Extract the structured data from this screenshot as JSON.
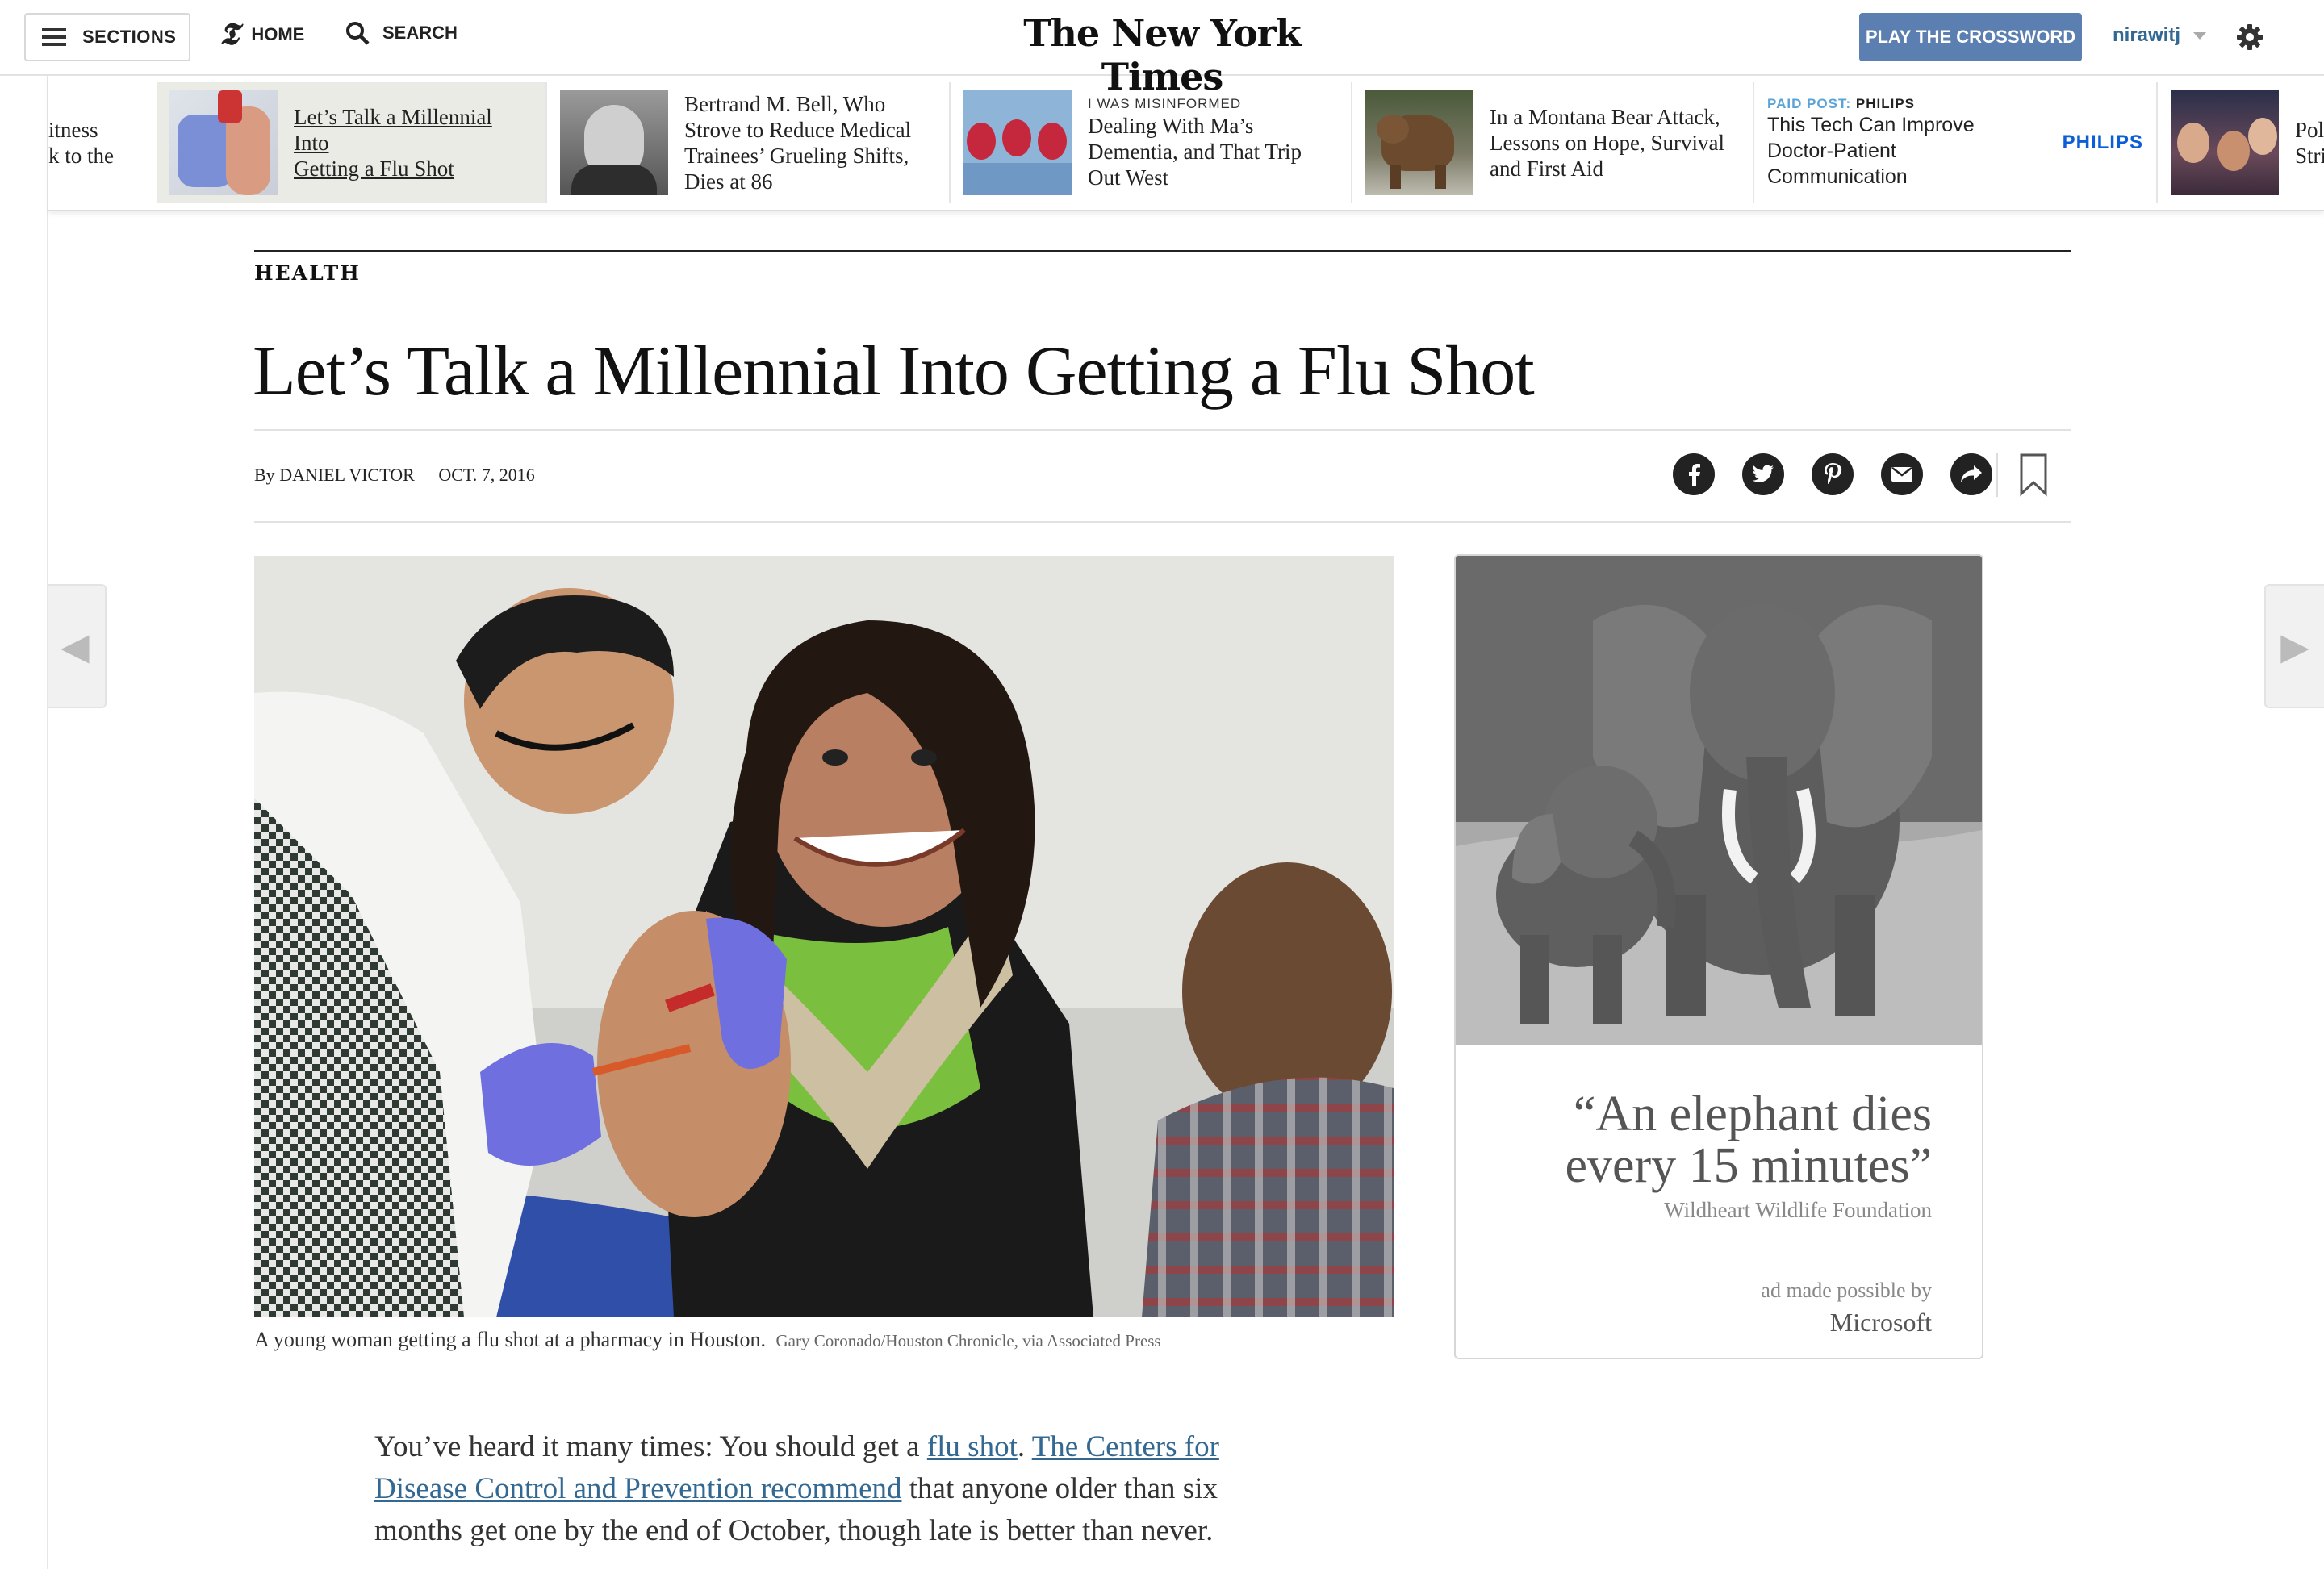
{
  "topbar": {
    "sections_label": "SECTIONS",
    "home_label": "HOME",
    "search_label": "SEARCH",
    "masthead": "The New York Times",
    "crossword_label": "PLAY THE CROSSWORD",
    "username": "nirawitj",
    "crossword_color": "#5a7fb0"
  },
  "ribbon": {
    "items": [
      {
        "text": "Fitness ... to the",
        "line1": "itness",
        "line2": "k to the"
      },
      {
        "text": "Let’s Talk a Millennial Into Getting a Flu Shot",
        "line1": "Let’s Talk a Millennial Into",
        "line2": "Getting a Flu Shot"
      },
      {
        "line1": "Bertrand M. Bell, Who",
        "line2": "Strove to Reduce Medical",
        "line3": "Trainees’ Grueling Shifts,",
        "line4": "Dies at 86"
      },
      {
        "kicker": "I WAS MISINFORMED",
        "line1": "Dealing With Ma’s",
        "line2": "Dementia, and That Trip",
        "line3": "Out West"
      },
      {
        "line1": "In a Montana Bear Attack,",
        "line2": "Lessons on Hope, Survival",
        "line3": "and First Aid"
      },
      {
        "paid_label": "PAID POST:",
        "paid_brand": "PHILIPS",
        "line1": "This Tech Can Improve",
        "line2": "Doctor-Patient",
        "line3": "Communication",
        "logo": "PHILIPS"
      },
      {
        "line1": "Pol",
        "line2": "Stri"
      }
    ]
  },
  "article": {
    "section": "HEALTH",
    "headline": "Let’s Talk a Millennial Into Getting a Flu Shot",
    "byline_prefix": "By",
    "author": "DANIEL VICTOR",
    "date": "OCT. 7, 2016",
    "share_icons": [
      "facebook-icon",
      "twitter-icon",
      "pinterest-icon",
      "email-icon",
      "share-icon"
    ],
    "caption": "A young woman getting a flu shot at a pharmacy in Houston.",
    "credit": "Gary Coronado/Houston Chronicle, via Associated Press",
    "body": {
      "p1_a": "You’ve heard it many times: You should get a ",
      "link1": "flu shot",
      "p1_b": ". ",
      "link2": "The Centers for Disease Control and Prevention recommend",
      "p1_c": " that anyone older than six months get one by the end of October, though late is better than never."
    },
    "link_color": "#326891"
  },
  "ad": {
    "quote": "“An elephant dies every 15 minutes”",
    "org": "Wildheart Wildlife Foundation",
    "made_by": "ad made possible by",
    "sponsor": "Microsoft"
  }
}
